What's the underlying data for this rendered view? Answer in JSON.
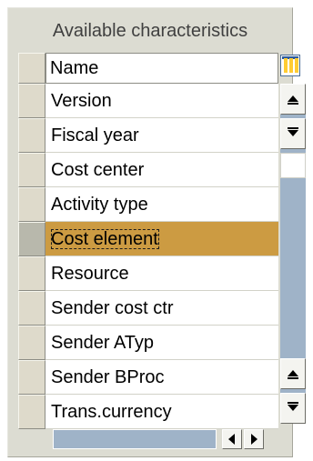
{
  "panel": {
    "title": "Available characteristics"
  },
  "table": {
    "header": "Name",
    "rows": [
      {
        "label": "Version"
      },
      {
        "label": "Fiscal year"
      },
      {
        "label": "Cost center"
      },
      {
        "label": "Activity type"
      },
      {
        "label": "Cost element",
        "selected": true
      },
      {
        "label": "Resource"
      },
      {
        "label": "Sender cost ctr"
      },
      {
        "label": "Sender ATyp"
      },
      {
        "label": "Sender BProc"
      },
      {
        "label": "Trans.currency"
      }
    ],
    "selected_row_color": "#cc9b42"
  },
  "icons": {
    "column_config": "column-settings-icon",
    "scroll_up": "arrow-up-icon",
    "scroll_down": "arrow-down-icon",
    "scroll_left": "arrow-left-icon",
    "scroll_right": "arrow-right-icon"
  },
  "colors": {
    "panel_bg": "#dcdcd2",
    "scroll_track": "#9fb3c8",
    "selection": "#cc9b42"
  }
}
